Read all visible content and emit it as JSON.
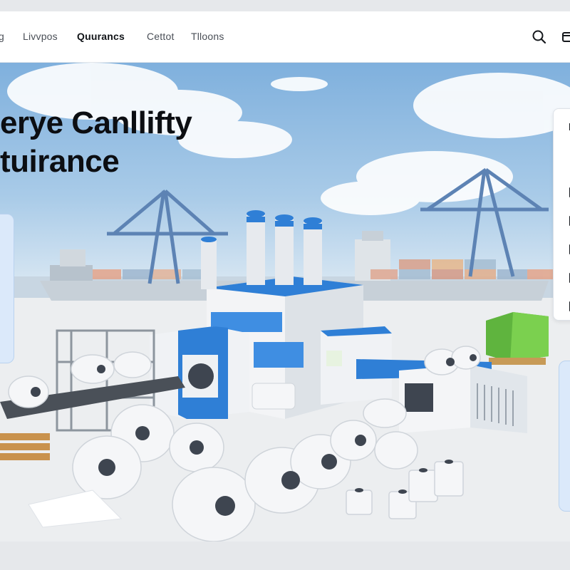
{
  "nav": {
    "items": [
      {
        "label": "g"
      },
      {
        "label": "Livvpos"
      },
      {
        "label": "Quurancs"
      },
      {
        "label": "Cettot"
      },
      {
        "label": "Tlloons"
      }
    ],
    "search_icon": "search-icon",
    "cart_icon": "cart-icon"
  },
  "hero": {
    "title_line1": "erye Canllifty",
    "title_line2": "tuirance"
  },
  "colors": {
    "accent": "#2f7fd6",
    "navy": "#1b2a55",
    "container_green": "#6cc24a"
  }
}
